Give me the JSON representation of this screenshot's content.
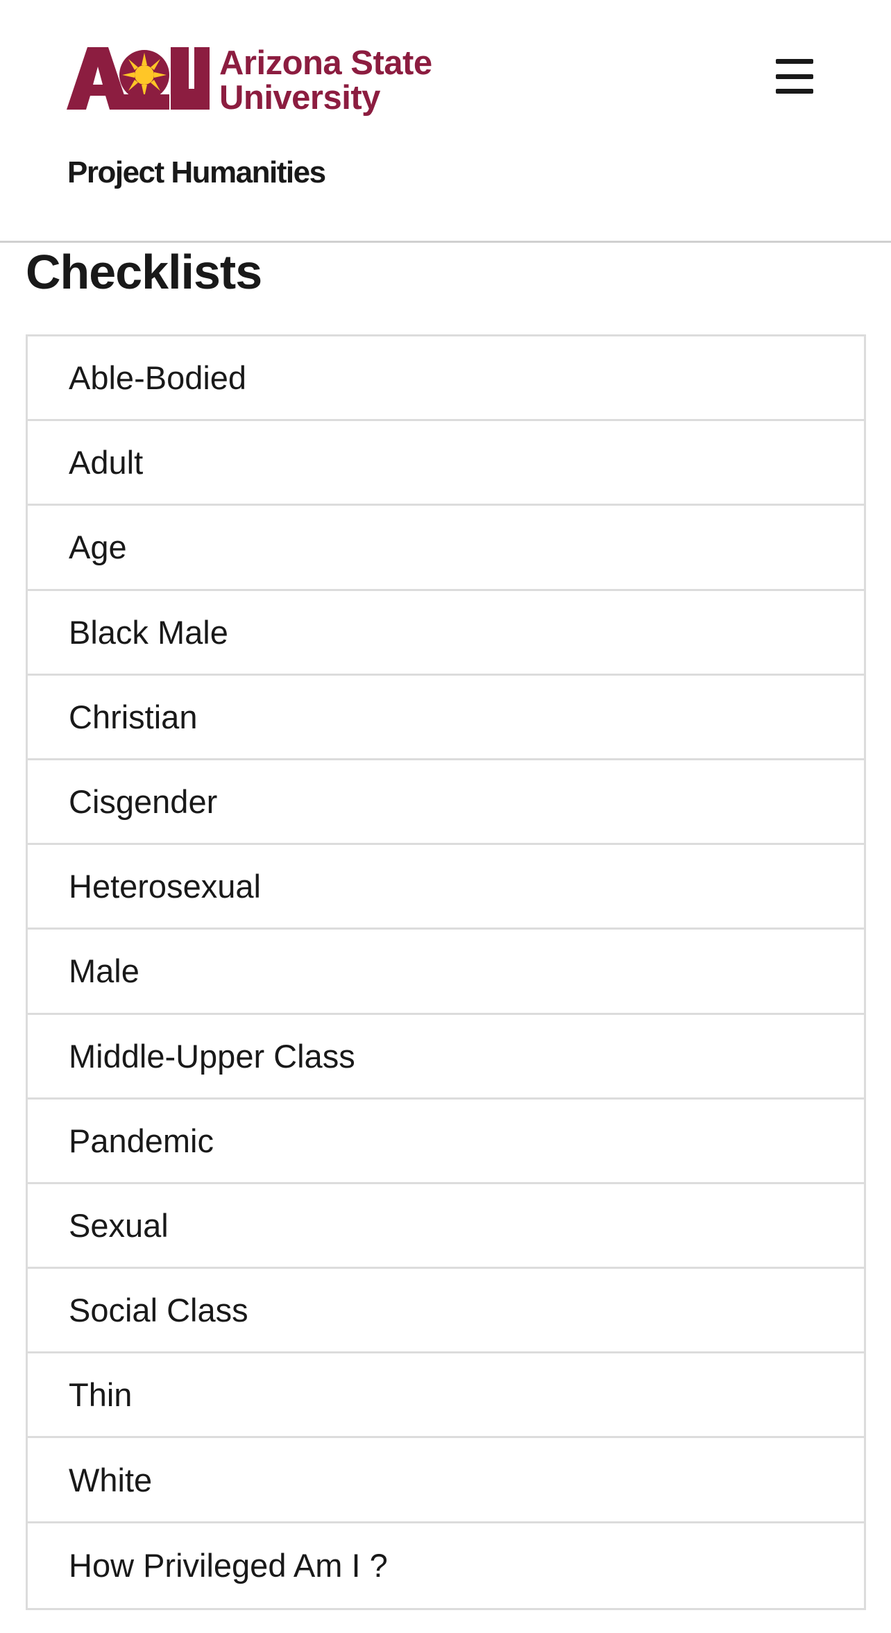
{
  "header": {
    "logo": {
      "mark_text": "ASU",
      "line1": "Arizona State",
      "line2": "University",
      "brand_color": "#8c1d40",
      "sun_color": "#ffc627"
    },
    "menu_icon": "hamburger-menu-icon",
    "site_title": "Project Humanities"
  },
  "main": {
    "title": "Checklists",
    "items": [
      {
        "label": "Able-Bodied"
      },
      {
        "label": "Adult"
      },
      {
        "label": "Age"
      },
      {
        "label": "Black Male"
      },
      {
        "label": "Christian"
      },
      {
        "label": "Cisgender"
      },
      {
        "label": "Heterosexual"
      },
      {
        "label": "Male"
      },
      {
        "label": "Middle-Upper Class"
      },
      {
        "label": "Pandemic"
      },
      {
        "label": "Sexual"
      },
      {
        "label": "Social Class"
      },
      {
        "label": "Thin"
      },
      {
        "label": "White"
      },
      {
        "label": "How Privileged Am I ?"
      }
    ]
  }
}
